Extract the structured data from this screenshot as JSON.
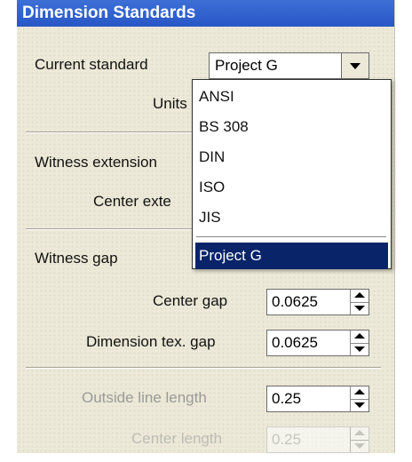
{
  "window": {
    "title": "Dimension Standards"
  },
  "fields": {
    "current_standard_label": "Current standard",
    "current_standard_value": "Project G",
    "units_label": "Units",
    "witness_extension_label": "Witness extension",
    "center_extension_label": "Center exte",
    "witness_gap_label": "Witness gap",
    "center_gap_label": "Center gap",
    "center_gap_value": "0.0625",
    "dimension_text_gap_label": "Dimension tex. gap",
    "dimension_text_gap_value": "0.0625",
    "outside_line_length_label": "Outside line length",
    "outside_line_length_value": "0.25",
    "center_length_label": "Center length",
    "center_length_value": "0.25"
  },
  "dropdown": {
    "options": [
      "ANSI",
      "BS 308",
      "DIN",
      "ISO",
      "JIS"
    ],
    "selected": "Project G"
  },
  "colors": {
    "titlebar": "#2857c6",
    "selection": "#0a246a"
  }
}
